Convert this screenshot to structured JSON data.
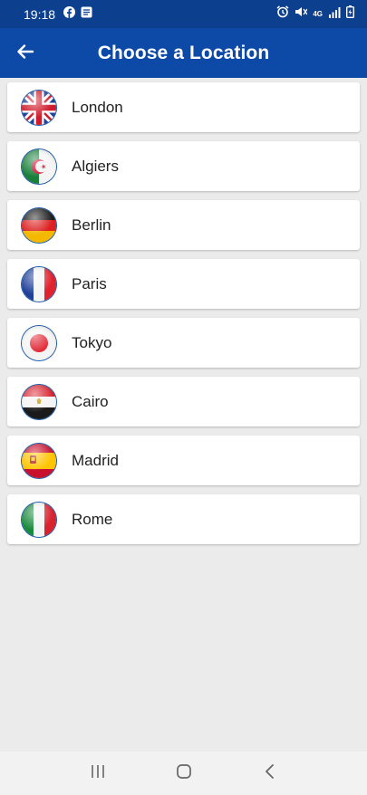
{
  "status_bar": {
    "time": "19:18",
    "left_icons": [
      "facebook-icon",
      "message-icon"
    ],
    "right_icons": [
      "alarm-icon",
      "mute-icon",
      "network-4g-icon",
      "signal-icon",
      "battery-icon"
    ],
    "network_label": "4G"
  },
  "app_bar": {
    "title": "Choose a Location",
    "back_icon": "arrow-left-icon"
  },
  "locations": [
    {
      "name": "London",
      "flag": "uk-flag-icon"
    },
    {
      "name": "Algiers",
      "flag": "algeria-flag-icon"
    },
    {
      "name": "Berlin",
      "flag": "germany-flag-icon"
    },
    {
      "name": "Paris",
      "flag": "france-flag-icon"
    },
    {
      "name": "Tokyo",
      "flag": "japan-flag-icon"
    },
    {
      "name": "Cairo",
      "flag": "egypt-flag-icon"
    },
    {
      "name": "Madrid",
      "flag": "spain-flag-icon"
    },
    {
      "name": "Rome",
      "flag": "italy-flag-icon"
    }
  ],
  "nav_bar": {
    "buttons": [
      "recents-icon",
      "home-icon",
      "back-icon"
    ]
  },
  "colors": {
    "status_bar": "#0c3f8e",
    "app_bar": "#0d4aa8",
    "background": "#ebebeb",
    "card": "#ffffff"
  }
}
